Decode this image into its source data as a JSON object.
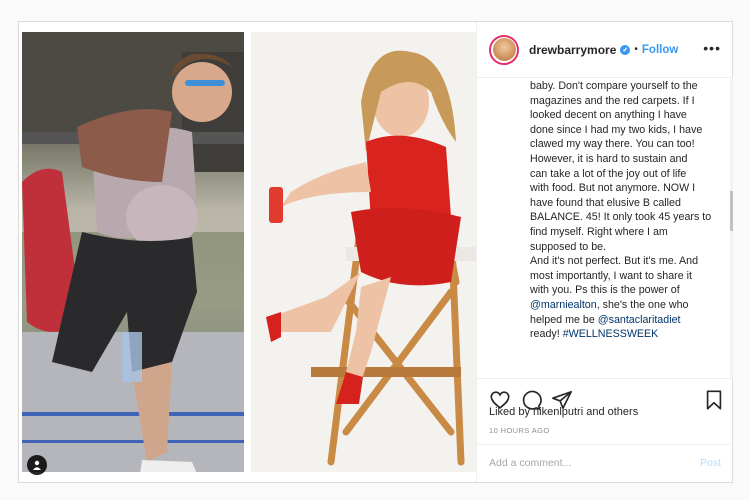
{
  "post": {
    "username": "drewbarrymore",
    "verified_mark": "✔",
    "separator": "•",
    "follow_label": "Follow",
    "more_label": "•••",
    "caption_lines": [
      {
        "parts": [
          {
            "text": "baby. Don't compare yourself to the"
          }
        ]
      },
      {
        "parts": [
          {
            "text": "magazines and the red carpets. If I"
          }
        ]
      },
      {
        "parts": [
          {
            "text": "looked decent on anything I have"
          }
        ]
      },
      {
        "parts": [
          {
            "text": "done since I had my two kids, I have"
          }
        ]
      },
      {
        "parts": [
          {
            "text": "clawed my way there. You can too!"
          }
        ]
      },
      {
        "parts": [
          {
            "text": "However, it is hard to sustain and"
          }
        ]
      },
      {
        "parts": [
          {
            "text": "can take a lot of the joy out of life"
          }
        ]
      },
      {
        "parts": [
          {
            "text": "with food. But not anymore. NOW I"
          }
        ]
      },
      {
        "parts": [
          {
            "text": "have found that elusive B called"
          }
        ]
      },
      {
        "parts": [
          {
            "text": "BALANCE. 45! It only took 45 years to"
          }
        ]
      },
      {
        "parts": [
          {
            "text": "find myself. Right where I am"
          }
        ]
      },
      {
        "parts": [
          {
            "text": "supposed to be."
          }
        ]
      },
      {
        "parts": [
          {
            "text": "And it's not perfect. But it's me. And"
          }
        ]
      },
      {
        "parts": [
          {
            "text": "most importantly, I want to share it"
          }
        ]
      },
      {
        "parts": [
          {
            "text": "with you. Ps this is the power of"
          }
        ]
      },
      {
        "parts": [
          {
            "text": "@marniealton",
            "link": true
          },
          {
            "text": ", she's the one who"
          }
        ]
      },
      {
        "parts": [
          {
            "text": "helped me be "
          },
          {
            "text": "@santaclaritadiet",
            "link": true
          }
        ]
      },
      {
        "parts": [
          {
            "text": "ready! "
          },
          {
            "text": "#WELLNESSWEEK",
            "link": true
          }
        ]
      }
    ],
    "caption_time": "10h",
    "liked_by": "Liked by nikenlputri and others",
    "posted_ago": "10 HOURS AGO",
    "comment_placeholder": "Add a comment...",
    "post_label": "Post"
  },
  "icons": {
    "like": "heart-icon",
    "comment": "comment-icon",
    "share": "paper-plane-icon",
    "save": "bookmark-icon",
    "tag": "user-tag-icon"
  },
  "colors": {
    "link": "#003569",
    "follow": "#3897f0",
    "post_disabled": "#b2dffc",
    "avatar_ring": "#e1306c"
  }
}
